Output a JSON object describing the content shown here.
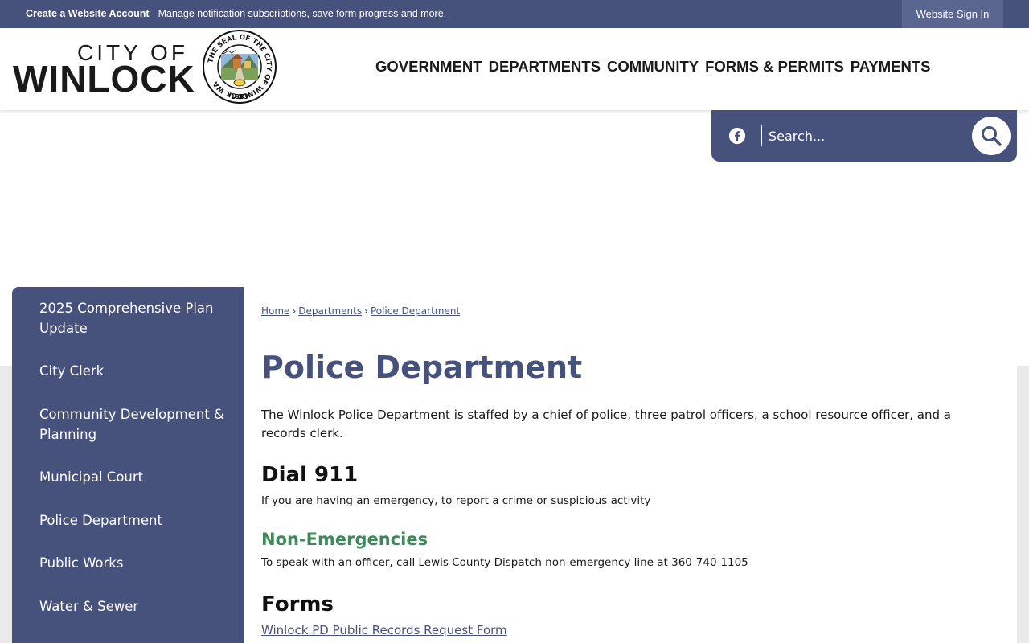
{
  "topbar": {
    "create_account": "Create a Website Account",
    "message": " - Manage notification subscriptions, save form progress and more.",
    "sign_in": "Website Sign In"
  },
  "header": {
    "logo_line1": "CITY OF",
    "logo_line2": "WINLOCK",
    "seal_text": "THE SEAL OF THE CITY OF WINLOCK WA",
    "seal_year": "1883"
  },
  "nav": {
    "items": [
      "GOVERNMENT",
      "DEPARTMENTS",
      "COMMUNITY",
      "FORMS & PERMITS",
      "PAYMENTS"
    ]
  },
  "search": {
    "placeholder": "Search..."
  },
  "sidebar": {
    "items": [
      "2025 Comprehensive Plan Update",
      "City Clerk",
      "Community Development & Planning",
      "Municipal Court",
      "Police Department",
      "Public Works",
      "Water & Sewer"
    ]
  },
  "breadcrumb": [
    "Home",
    "Departments",
    "Police Department"
  ],
  "main": {
    "title": "Police Department",
    "intro": "The Winlock Police Department is staffed by a chief of police, three patrol officers, a school resource officer, and a records clerk.",
    "dial_heading": "Dial 911",
    "dial_text": "If you are having an emergency, to report a crime or suspicious activity",
    "non_emergency_heading": "Non-Emergencies",
    "non_emergency_text": "To speak with an officer, call Lewis County Dispatch non-emergency line at 360-740-1105",
    "forms_heading": "Forms",
    "forms_link": "Winlock PD Public Records Request Form"
  },
  "colors": {
    "primary": "#46527c",
    "accent_green": "#3c8a5a",
    "gray_bg": "#eaeaea"
  },
  "icons": {
    "social": "facebook-icon",
    "search": "search-icon",
    "seal": "city-seal-icon"
  }
}
